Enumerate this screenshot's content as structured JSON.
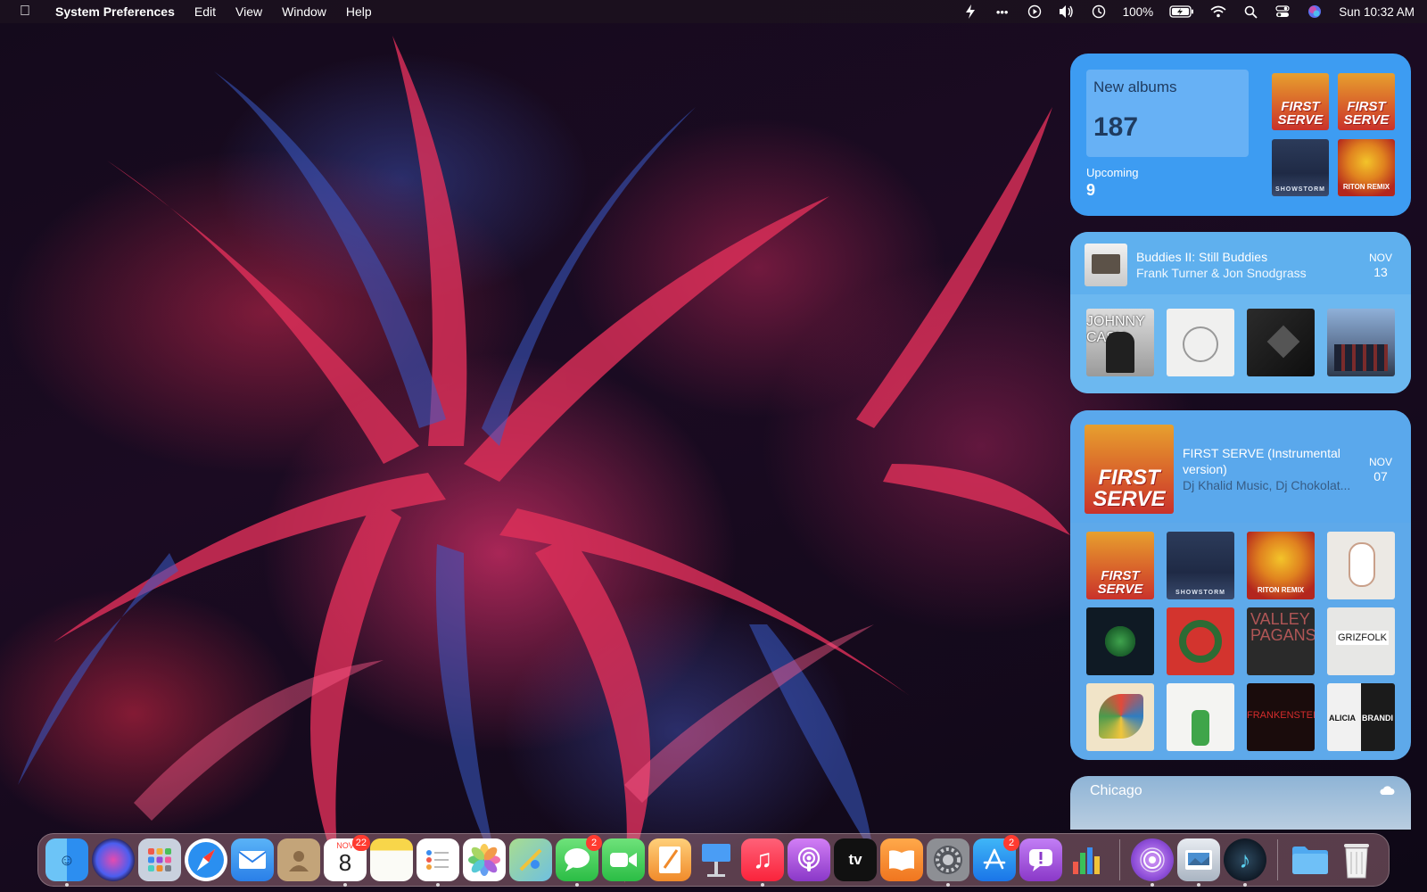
{
  "menubar": {
    "app_name": "System Preferences",
    "menus": [
      "Edit",
      "View",
      "Window",
      "Help"
    ],
    "battery": "100%",
    "clock": "Sun 10:32 AM"
  },
  "widgets": {
    "new_albums": {
      "label": "New albums",
      "count": "187",
      "upcoming_label": "Upcoming",
      "upcoming_count": "9",
      "covers": [
        {
          "text": "FIRST SERVE",
          "style": "fs"
        },
        {
          "text": "FIRST SERVE",
          "style": "fs"
        },
        {
          "text": "SHOWSTORM",
          "style": "show"
        },
        {
          "text": "RITON REMIX",
          "style": "oh"
        }
      ]
    },
    "upcoming_release": {
      "title": "Buddies II: Still Buddies",
      "artist": "Frank Turner & Jon Snodgrass",
      "month": "NOV",
      "day": "13",
      "covers": [
        {
          "text": "JOHNNY CASH",
          "style": "cash"
        },
        {
          "text": "",
          "style": "white"
        },
        {
          "text": "",
          "style": "dark"
        },
        {
          "text": "",
          "style": "band"
        }
      ]
    },
    "latest_release": {
      "title": "FIRST SERVE (Instrumental version)",
      "artist": "Dj Khalid Music, Dj Chokolat...",
      "month": "NOV",
      "day": "07",
      "cover_text": "FIRST SERVE",
      "grid": [
        {
          "text": "FIRST SERVE",
          "style": "fs"
        },
        {
          "text": "SHOWSTORM",
          "style": "show"
        },
        {
          "text": "RITON REMIX",
          "style": "oh"
        },
        {
          "text": "",
          "style": "kid"
        },
        {
          "text": "",
          "style": "balancers"
        },
        {
          "text": "",
          "style": "wreath"
        },
        {
          "text": "VALLEY PAGANS",
          "style": "valley"
        },
        {
          "text": "GRIZFOLK",
          "style": "grizfolk"
        },
        {
          "text": "",
          "style": "colorful"
        },
        {
          "text": "",
          "style": "deer"
        },
        {
          "text": "FRANKENSTEIN",
          "style": "frank"
        },
        {
          "text": "ALICIA BRANDI",
          "style": "alicia"
        }
      ]
    },
    "weather": {
      "city": "Chicago"
    }
  },
  "dock": {
    "apps": [
      {
        "name": "Finder",
        "icon": "finder-icon",
        "color": "#2c8ef0",
        "running": true
      },
      {
        "name": "Siri",
        "icon": "siri-icon",
        "color": "#3a2b7a",
        "running": false
      },
      {
        "name": "Launchpad",
        "icon": "launchpad-icon",
        "color": "#9aa7b8",
        "running": false
      },
      {
        "name": "Safari",
        "icon": "safari-icon",
        "color": "#2a7ff0",
        "running": false
      },
      {
        "name": "Mail",
        "icon": "mail-icon",
        "color": "#3a93f2",
        "running": false
      },
      {
        "name": "Contacts",
        "icon": "contacts-icon",
        "color": "#b08f6a",
        "running": false
      },
      {
        "name": "Calendar",
        "icon": "calendar-icon",
        "color": "#ffffff",
        "running": true,
        "badge": "22",
        "label_month": "NOV",
        "label_day": "8"
      },
      {
        "name": "Notes",
        "icon": "notes-icon",
        "color": "#f8d64a",
        "running": false
      },
      {
        "name": "Reminders",
        "icon": "reminders-icon",
        "color": "#ffffff",
        "running": true
      },
      {
        "name": "Photos",
        "icon": "photos-icon",
        "color": "#ffffff",
        "running": false
      },
      {
        "name": "Maps",
        "icon": "maps-icon",
        "color": "#7fc46d",
        "running": false
      },
      {
        "name": "Messages",
        "icon": "messages-icon",
        "color": "#3cc94d",
        "running": true,
        "badge": "2"
      },
      {
        "name": "FaceTime",
        "icon": "facetime-icon",
        "color": "#36c24a",
        "running": false
      },
      {
        "name": "Pages",
        "icon": "pages-icon",
        "color": "#f0a23a",
        "running": false
      },
      {
        "name": "Keynote",
        "icon": "keynote-icon",
        "color": "#3a8df0",
        "running": false
      },
      {
        "name": "Music",
        "icon": "music-icon",
        "color": "#fc3d52",
        "running": true
      },
      {
        "name": "Podcasts",
        "icon": "podcasts-icon",
        "color": "#a34bd8",
        "running": false
      },
      {
        "name": "TV",
        "icon": "tv-icon",
        "color": "#1a1a1a",
        "running": false,
        "label": "tv"
      },
      {
        "name": "Books",
        "icon": "books-icon",
        "color": "#f08a2a",
        "running": false
      },
      {
        "name": "System Preferences",
        "icon": "system-preferences-icon",
        "color": "#8d8f94",
        "running": true
      },
      {
        "name": "App Store",
        "icon": "app-store-icon",
        "color": "#2a8bf2",
        "running": false,
        "badge": "2"
      },
      {
        "name": "Feedback Assistant",
        "icon": "feedback-icon",
        "color": "#9a4ad6",
        "running": false
      },
      {
        "name": "Numbers",
        "icon": "numbers-icon",
        "color": "#ffffff",
        "running": false
      }
    ],
    "recent_apps": [
      {
        "name": "Podcasts Beta",
        "icon": "radio-icon",
        "color": "#8f4fd9",
        "running": true
      },
      {
        "name": "Preview",
        "icon": "preview-icon",
        "color": "#d9dde4",
        "running": true
      },
      {
        "name": "Music Beta",
        "icon": "music-note-icon",
        "color": "#1c2f3d",
        "running": true
      }
    ],
    "folders": [
      {
        "name": "Downloads",
        "icon": "folder-icon",
        "color": "#4fa9f0"
      },
      {
        "name": "Trash",
        "icon": "trash-icon",
        "color": "#e6e6e6"
      }
    ]
  }
}
